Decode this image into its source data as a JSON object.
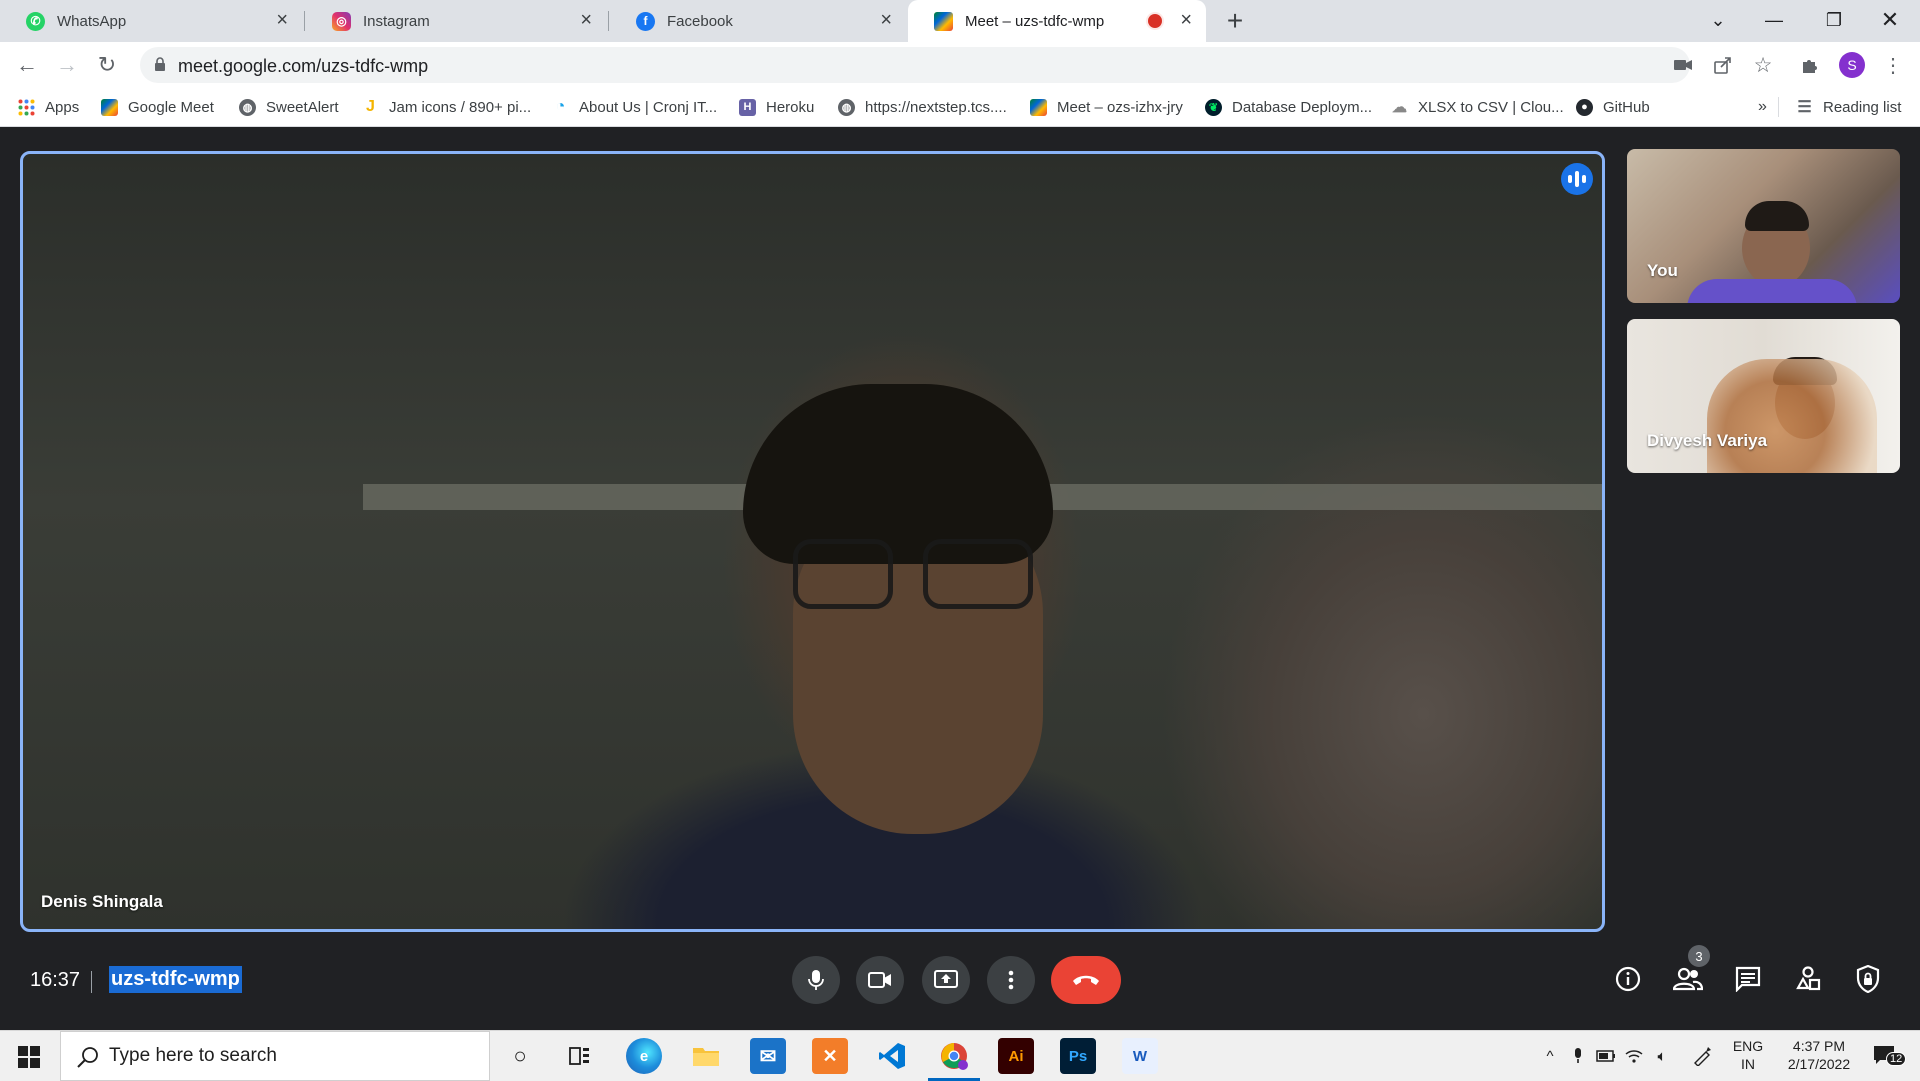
{
  "tabs": [
    {
      "title": "WhatsApp",
      "icon": "whatsapp-icon"
    },
    {
      "title": "Instagram",
      "icon": "instagram-icon"
    },
    {
      "title": "Facebook",
      "icon": "facebook-icon"
    },
    {
      "title": "Meet – uzs-tdfc-wmp",
      "icon": "google-meet-icon",
      "active": true,
      "recording": true
    }
  ],
  "address_bar": {
    "url": "meet.google.com/uzs-tdfc-wmp"
  },
  "profile": {
    "initial": "S"
  },
  "bookmarks": [
    {
      "label": "Apps",
      "icon": "apps-grid-icon"
    },
    {
      "label": "Google Meet",
      "icon": "google-meet-icon"
    },
    {
      "label": "SweetAlert",
      "icon": "globe-icon"
    },
    {
      "label": "Jam icons / 890+ pi...",
      "icon": "jam-icon"
    },
    {
      "label": "About Us | Cronj IT...",
      "icon": "cronj-icon"
    },
    {
      "label": "Heroku",
      "icon": "heroku-icon"
    },
    {
      "label": "https://nextstep.tcs....",
      "icon": "globe-icon"
    },
    {
      "label": "Meet – ozs-izhx-jry",
      "icon": "google-meet-icon"
    },
    {
      "label": "Database Deploym...",
      "icon": "mongodb-icon"
    },
    {
      "label": "XLSX to CSV | Clou...",
      "icon": "cloud-icon"
    },
    {
      "label": "GitHub",
      "icon": "github-icon"
    }
  ],
  "bookmarks_overflow": "»",
  "reading_list": "Reading list",
  "meet": {
    "main_participant": "Denis Shingala",
    "tiles": [
      {
        "name": "You"
      },
      {
        "name": "Divyesh Variya"
      }
    ],
    "time": "16:37",
    "meeting_code": "uzs-tdfc-wmp",
    "participants_count": "3"
  },
  "taskbar": {
    "search_placeholder": "Type here to search",
    "language": "ENG",
    "region": "IN",
    "time": "4:37 PM",
    "date": "2/17/2022",
    "notifications": "12"
  },
  "colors": {
    "accent_blue": "#1a73e8",
    "end_call_red": "#ea4335",
    "meet_background": "#202124"
  }
}
